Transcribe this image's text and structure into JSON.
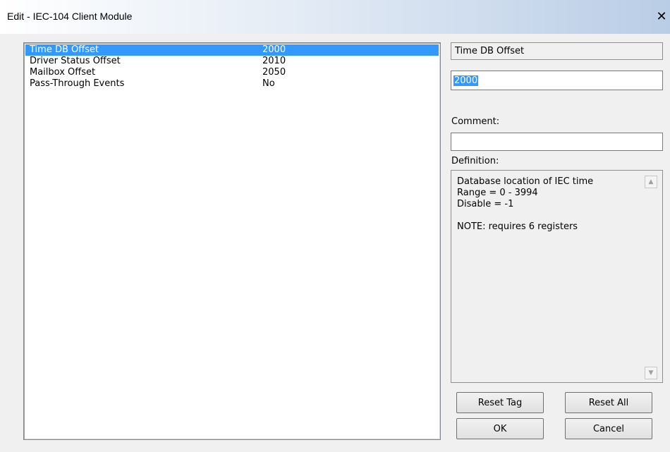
{
  "window": {
    "title": "Edit - IEC-104 Client Module",
    "close_glyph": "✕"
  },
  "params": [
    {
      "name": "Time DB Offset",
      "value": "2000",
      "selected": true
    },
    {
      "name": "Driver Status Offset",
      "value": "2010",
      "selected": false
    },
    {
      "name": "Mailbox Offset",
      "value": "2050",
      "selected": false
    },
    {
      "name": "Pass-Through Events",
      "value": "No",
      "selected": false
    }
  ],
  "editor": {
    "field_name": "Time DB Offset",
    "value": "2000",
    "comment_label": "Comment:",
    "comment_value": "",
    "definition_label": "Definition:",
    "definition_text": "Database location of IEC time\nRange = 0 - 3994\nDisable = -1\n\nNOTE: requires 6 registers"
  },
  "buttons": {
    "reset_tag": "Reset Tag",
    "reset_all": "Reset All",
    "ok": "OK",
    "cancel": "Cancel"
  },
  "colors": {
    "selection": "#3399ff",
    "titlebar_end": "#b9cde6"
  },
  "icons": {
    "close": "close-icon",
    "scroll_up": "scroll-up-icon",
    "scroll_down": "scroll-down-icon"
  }
}
